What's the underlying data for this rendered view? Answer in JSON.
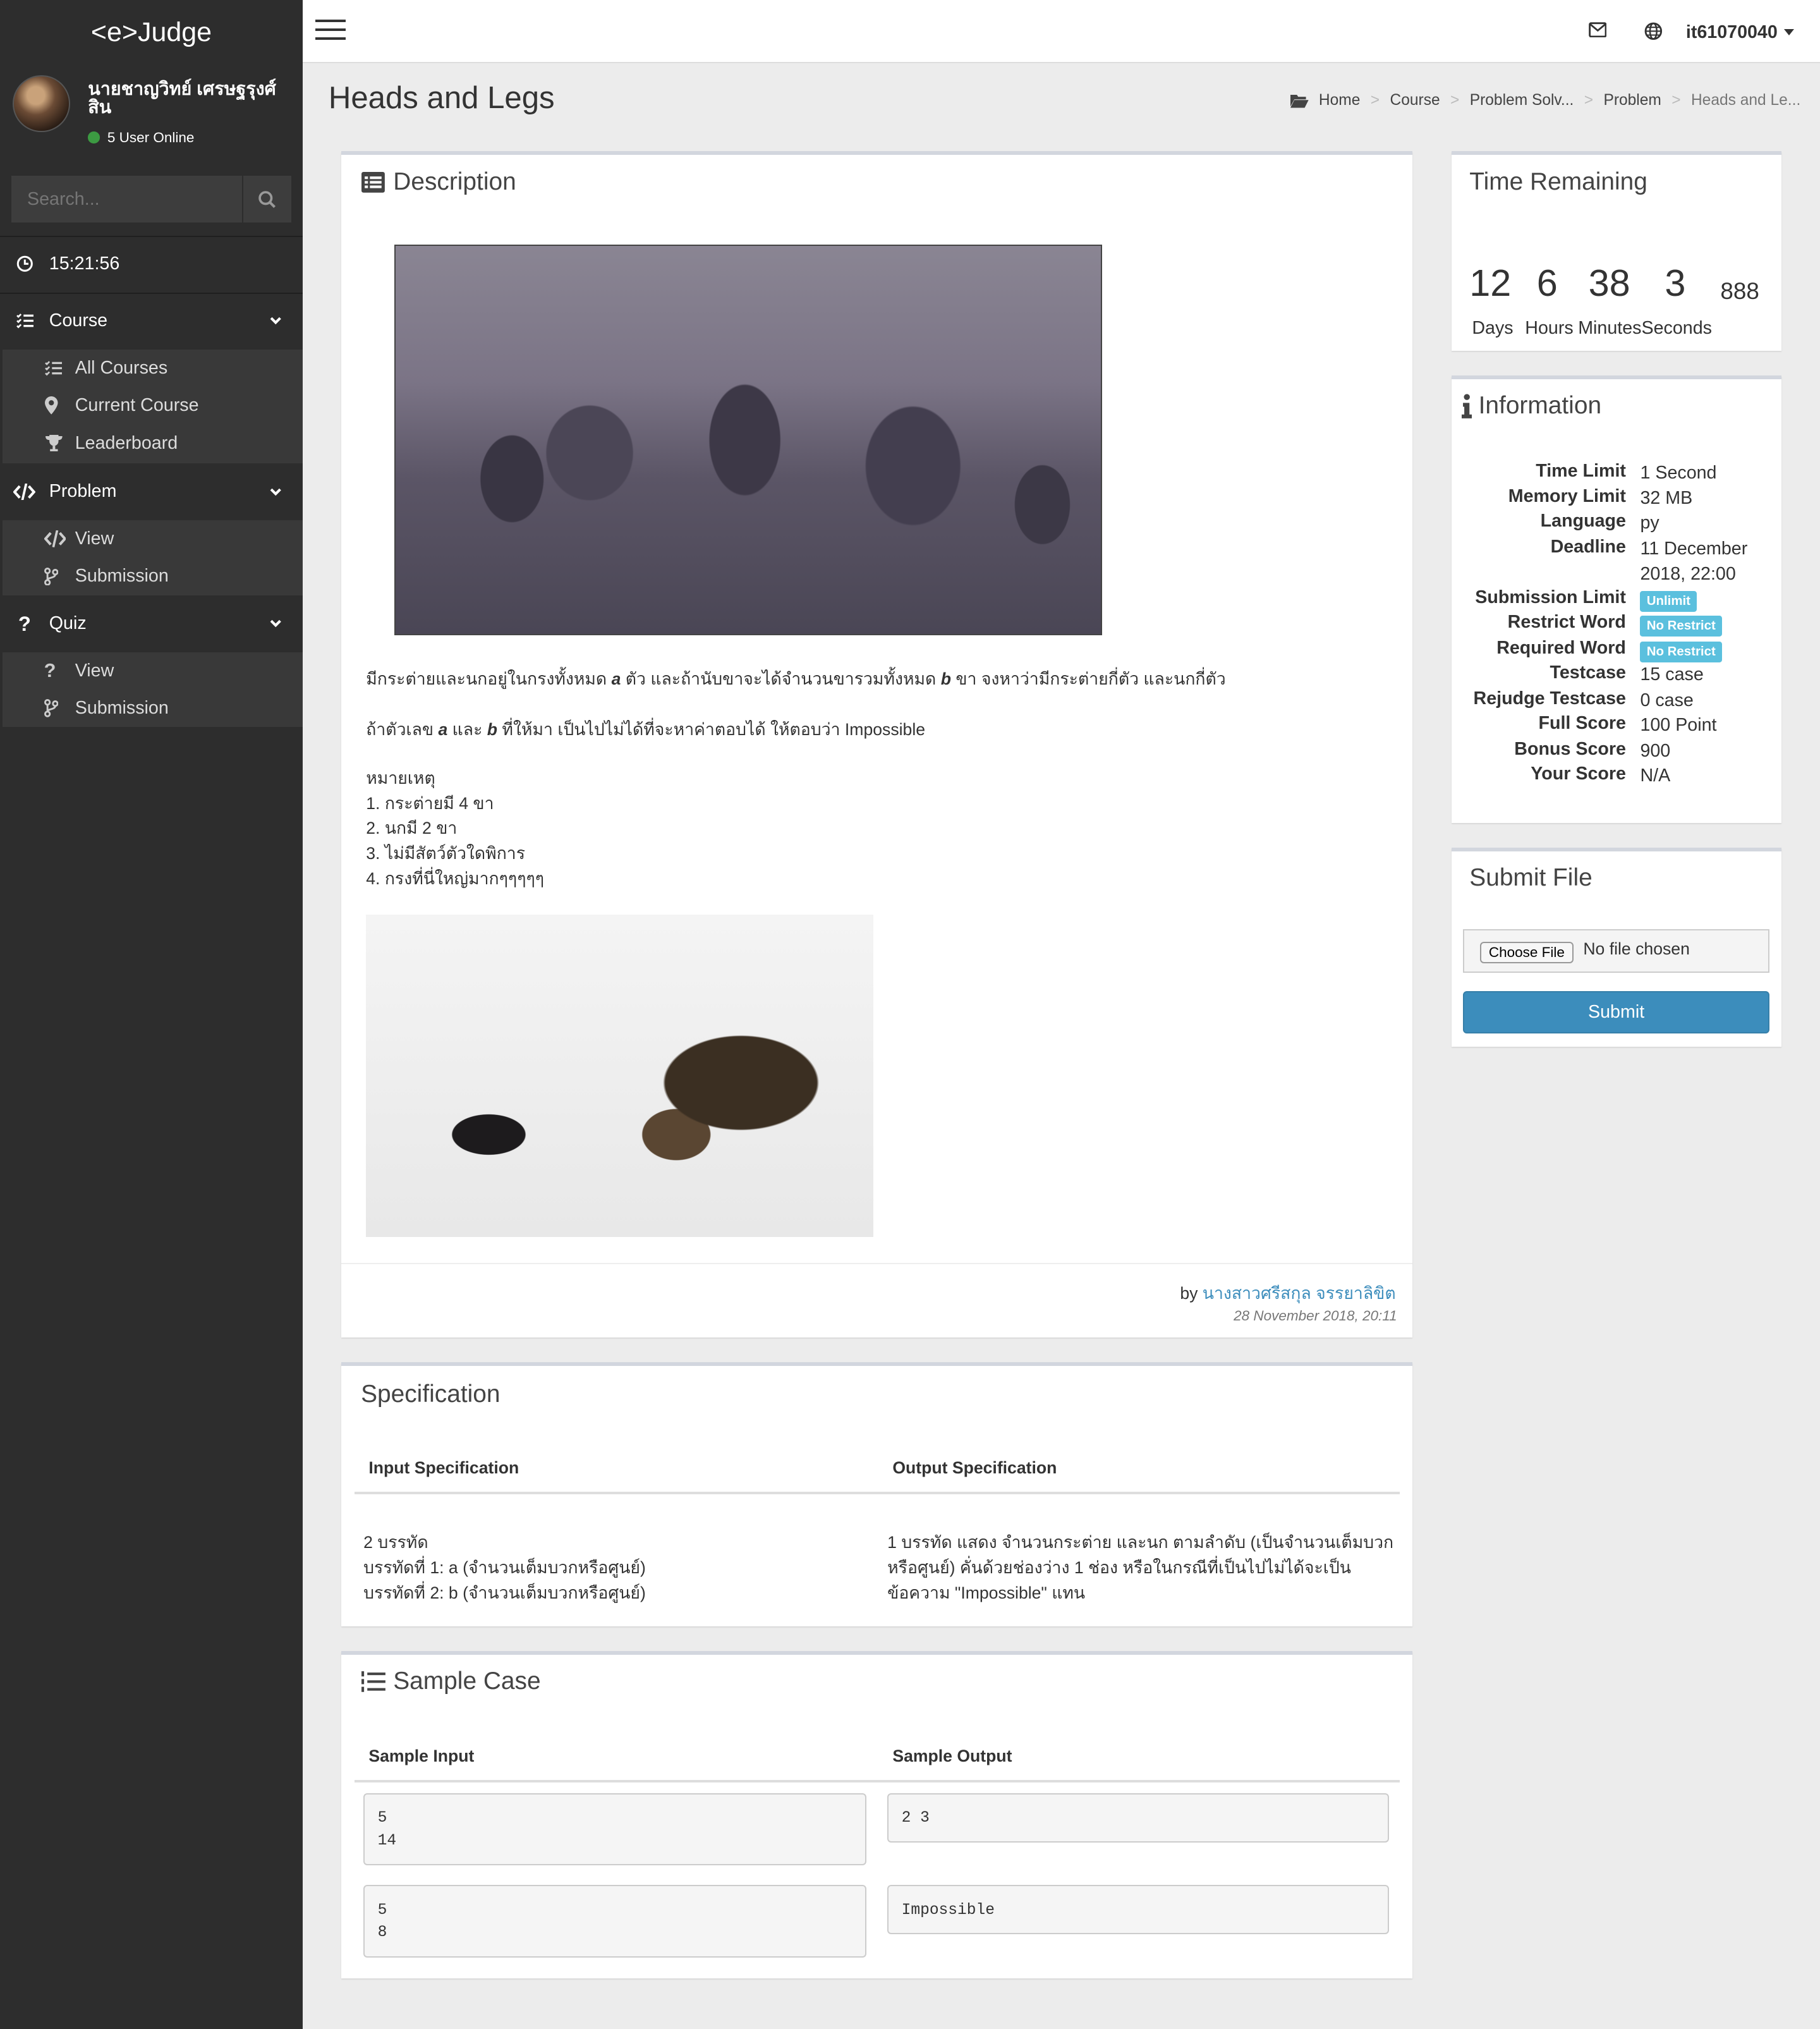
{
  "brand": "<e>Judge",
  "user": {
    "name": "นายชาญวิทย์ เศรษฐรุงศ์สิน",
    "online": "5 User Online"
  },
  "search": {
    "placeholder": "Search..."
  },
  "sidebar": {
    "clock": "15:21:56",
    "sections": [
      {
        "label": "Course",
        "items": [
          "All Courses",
          "Current Course",
          "Leaderboard"
        ]
      },
      {
        "label": "Problem",
        "items": [
          "View",
          "Submission"
        ]
      },
      {
        "label": "Quiz",
        "items": [
          "View",
          "Submission"
        ]
      }
    ]
  },
  "topbar": {
    "username": "it61070040"
  },
  "page": {
    "title": "Heads and Legs"
  },
  "breadcrumb": [
    "Home",
    "Course",
    "Problem Solv...",
    "Problem",
    "Heads and Le..."
  ],
  "description": {
    "title": "Description",
    "line1_a": "มีกระต่ายและนกอยู่ในกรงทั้งหมด",
    "var_a": "a",
    "line1_b": "ตัว และถ้านับขาจะได้จำนวนขารวมทั้งหมด",
    "var_b": "b",
    "line1_c": "ขา จงหาว่ามีกระต่ายกี่ตัว และนกกี่ตัว",
    "line2_a": "ถ้าตัวเลข",
    "line2_b": "และ",
    "line2_c": "ที่ให้มา เป็นไปไม่ได้ที่จะหาค่าตอบได้ ให้ตอบว่า Impossible",
    "notes_title": "หมายเหตุ",
    "notes": [
      "1. กระต่ายมี 4 ขา",
      "2. นกมี 2 ขา",
      "3. ไม่มีสัตว์ตัวใดพิการ",
      "4. กรงที่นี่ใหญ่มากๆๆๆๆๆ"
    ],
    "by": "by",
    "author": "นางสาวศรีสกุล จรรยาลิขิต",
    "date": "28 November 2018, 20:11"
  },
  "specification": {
    "title": "Specification",
    "input_header": "Input Specification",
    "output_header": "Output Specification",
    "input_lines": [
      "2 บรรทัด",
      "บรรทัดที่ 1: a (จำนวนเต็มบวกหรือศูนย์)",
      "บรรทัดที่ 2: b (จำนวนเต็มบวกหรือศูนย์)"
    ],
    "output_lines": [
      "1 บรรทัด แสดง จำนวนกระต่าย และนก ตามลำดับ (เป็นจำนวนเต็มบวก",
      "หรือศูนย์) คั่นด้วยช่องว่าง 1 ช่อง หรือในกรณีที่เป็นไปไม่ได้จะเป็น",
      "ข้อความ \"Impossible\" แทน"
    ]
  },
  "samples": {
    "title": "Sample Case",
    "input_header": "Sample Input",
    "output_header": "Sample Output",
    "cases": [
      {
        "input": "5\n14",
        "output": "2 3"
      },
      {
        "input": "5\n8",
        "output": "Impossible"
      }
    ]
  },
  "time_remaining": {
    "title": "Time Remaining",
    "days": "12",
    "hours": "6",
    "minutes": "38",
    "seconds": "3",
    "ms": "888",
    "labels": [
      "Days",
      "Hours",
      "Minutes",
      "Seconds"
    ]
  },
  "information": {
    "title": "Information",
    "rows": [
      {
        "key": "Time Limit",
        "value": "1 Second"
      },
      {
        "key": "Memory Limit",
        "value": "32 MB"
      },
      {
        "key": "Language",
        "value": "py"
      },
      {
        "key": "Deadline",
        "value": "11 December 2018, 22:00"
      },
      {
        "key": "Submission Limit",
        "badge": "Unlimit"
      },
      {
        "key": "Restrict Word",
        "badge": "No Restrict"
      },
      {
        "key": "Required Word",
        "badge": "No Restrict"
      },
      {
        "key": "Testcase",
        "value": "15 case"
      },
      {
        "key": "Rejudge Testcase",
        "value": "0 case"
      },
      {
        "key": "Full Score",
        "value": "100 Point"
      },
      {
        "key": "Bonus Score",
        "value": "900"
      },
      {
        "key": "Your Score",
        "value": "N/A"
      }
    ]
  },
  "submit": {
    "title": "Submit File",
    "choose": "Choose File",
    "no_file": "No file chosen",
    "button": "Submit"
  },
  "colors": {
    "sidebar": "#2d2d2d",
    "accent": "#3c8dbc",
    "badge": "#5bc0de",
    "online": "#3c9a42"
  }
}
